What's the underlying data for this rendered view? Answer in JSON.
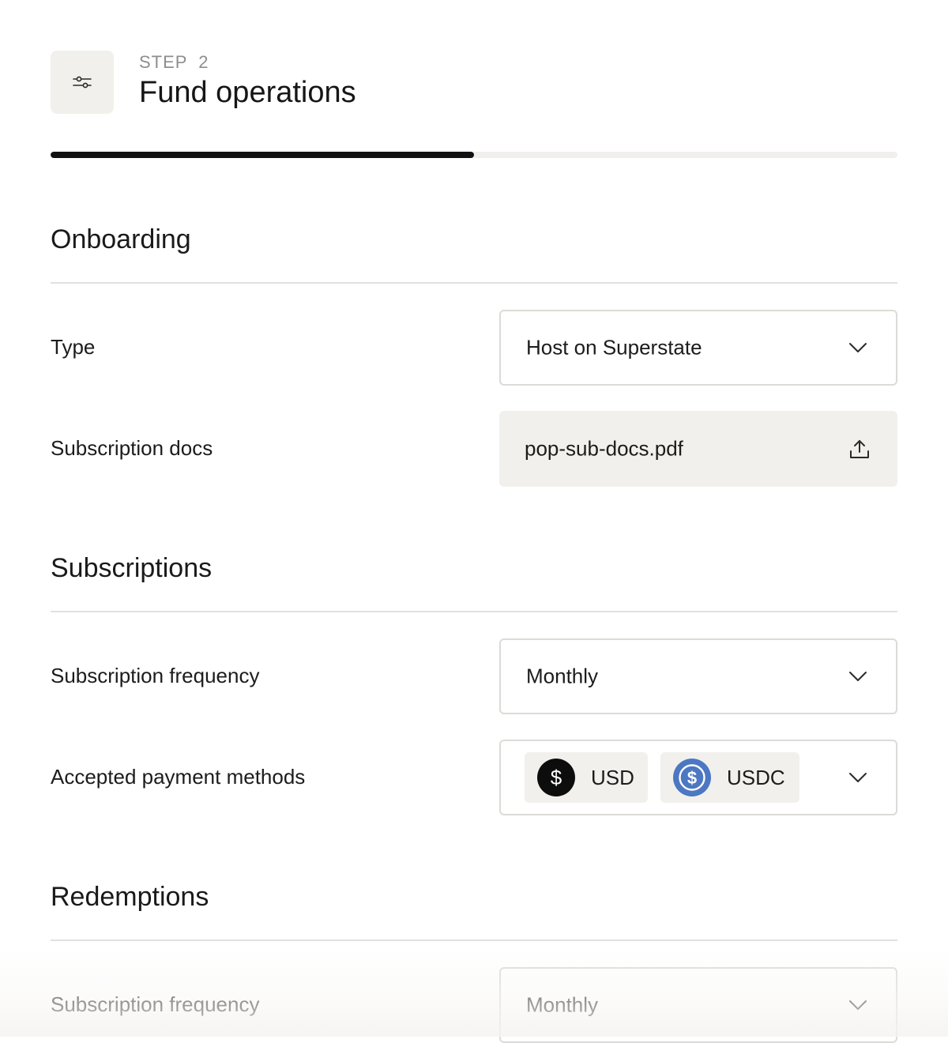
{
  "header": {
    "step_label": "STEP  2",
    "title": "Fund operations",
    "icon": "sliders-icon",
    "progress": 0.5
  },
  "sections": {
    "onboarding": {
      "title": "Onboarding",
      "type": {
        "label": "Type",
        "value": "Host on Superstate",
        "icon": "chevron-down-icon"
      },
      "subscription_docs": {
        "label": "Subscription docs",
        "value": "pop-sub-docs.pdf",
        "icon": "upload-icon"
      }
    },
    "subscriptions": {
      "title": "Subscriptions",
      "frequency": {
        "label": "Subscription frequency",
        "value": "Monthly",
        "icon": "chevron-down-icon"
      },
      "payment_methods": {
        "label": "Accepted payment methods",
        "options": [
          {
            "label": "USD",
            "icon": "dollar-icon"
          },
          {
            "label": "USDC",
            "icon": "usdc-icon"
          }
        ],
        "icon": "chevron-down-icon"
      }
    },
    "redemptions": {
      "title": "Redemptions",
      "frequency": {
        "label": "Subscription frequency",
        "value": "Monthly",
        "icon": "chevron-down-icon"
      }
    }
  },
  "colors": {
    "accent": "#111111",
    "surface": "#f1f0ec",
    "border": "#dcdbd7",
    "usdc_blue": "#4c77c2"
  }
}
